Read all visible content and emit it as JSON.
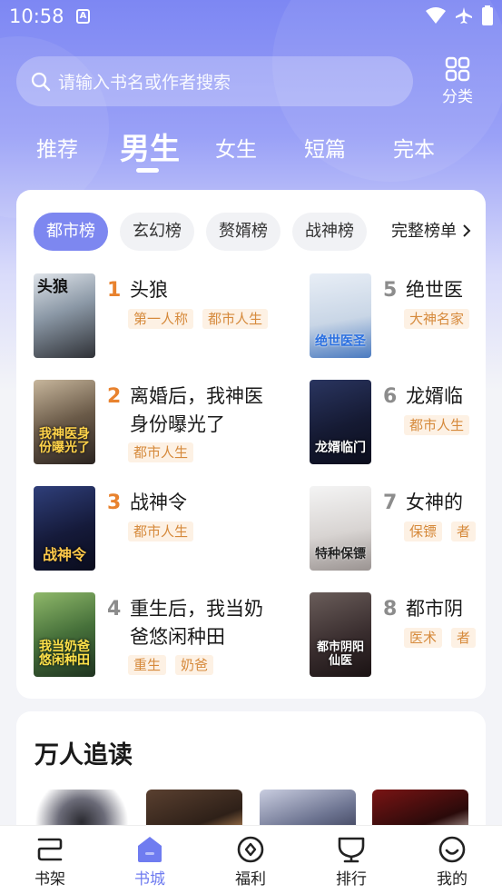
{
  "status": {
    "time": "10:58",
    "indicator": "A"
  },
  "search": {
    "placeholder": "请输入书名或作者搜索"
  },
  "category_button": {
    "label": "分类"
  },
  "tabs": [
    {
      "label": "推荐"
    },
    {
      "label": "男生",
      "active": true
    },
    {
      "label": "女生"
    },
    {
      "label": "短篇"
    },
    {
      "label": "完本"
    }
  ],
  "ranking": {
    "chips": [
      {
        "label": "都市榜",
        "active": true
      },
      {
        "label": "玄幻榜"
      },
      {
        "label": "赘婿榜"
      },
      {
        "label": "战神榜"
      }
    ],
    "more_label": "完整榜单",
    "books": [
      {
        "rank": "1",
        "title": "头狼",
        "tags": [
          "第一人称",
          "都市人生"
        ],
        "cover_text": "头狼"
      },
      {
        "rank": "2",
        "title": "离婚后，我神医身份曝光了",
        "tags": [
          "都市人生"
        ],
        "cover_text": "我神医身份曝光了"
      },
      {
        "rank": "3",
        "title": "战神令",
        "tags": [
          "都市人生"
        ],
        "cover_text": "战神令"
      },
      {
        "rank": "4",
        "title": "重生后，我当奶爸悠闲种田",
        "tags": [
          "重生",
          "奶爸"
        ],
        "cover_text": "我当奶爸悠闲种田"
      },
      {
        "rank": "5",
        "title": "绝世医",
        "tags": [
          "大神名家"
        ],
        "cover_text": "绝世医圣"
      },
      {
        "rank": "6",
        "title": "龙婿临",
        "tags": [
          "都市人生"
        ],
        "cover_text": "龙婿临门"
      },
      {
        "rank": "7",
        "title": "女神的",
        "tags": [
          "保镖",
          "者"
        ],
        "cover_text": "特种保镖"
      },
      {
        "rank": "8",
        "title": "都市阴",
        "tags": [
          "医术",
          "者"
        ],
        "cover_text": "都市阴阳仙医"
      }
    ]
  },
  "section2": {
    "title": "万人追读"
  },
  "bottom_nav": [
    {
      "label": "书架"
    },
    {
      "label": "书城",
      "active": true
    },
    {
      "label": "福利"
    },
    {
      "label": "排行"
    },
    {
      "label": "我的"
    }
  ],
  "colors": {
    "accent": "#7d87f0",
    "rank_top": "#e8822e",
    "rank_other": "#8c8c8c",
    "tag_bg": "#fdf1e4",
    "tag_text": "#d68a3c"
  }
}
